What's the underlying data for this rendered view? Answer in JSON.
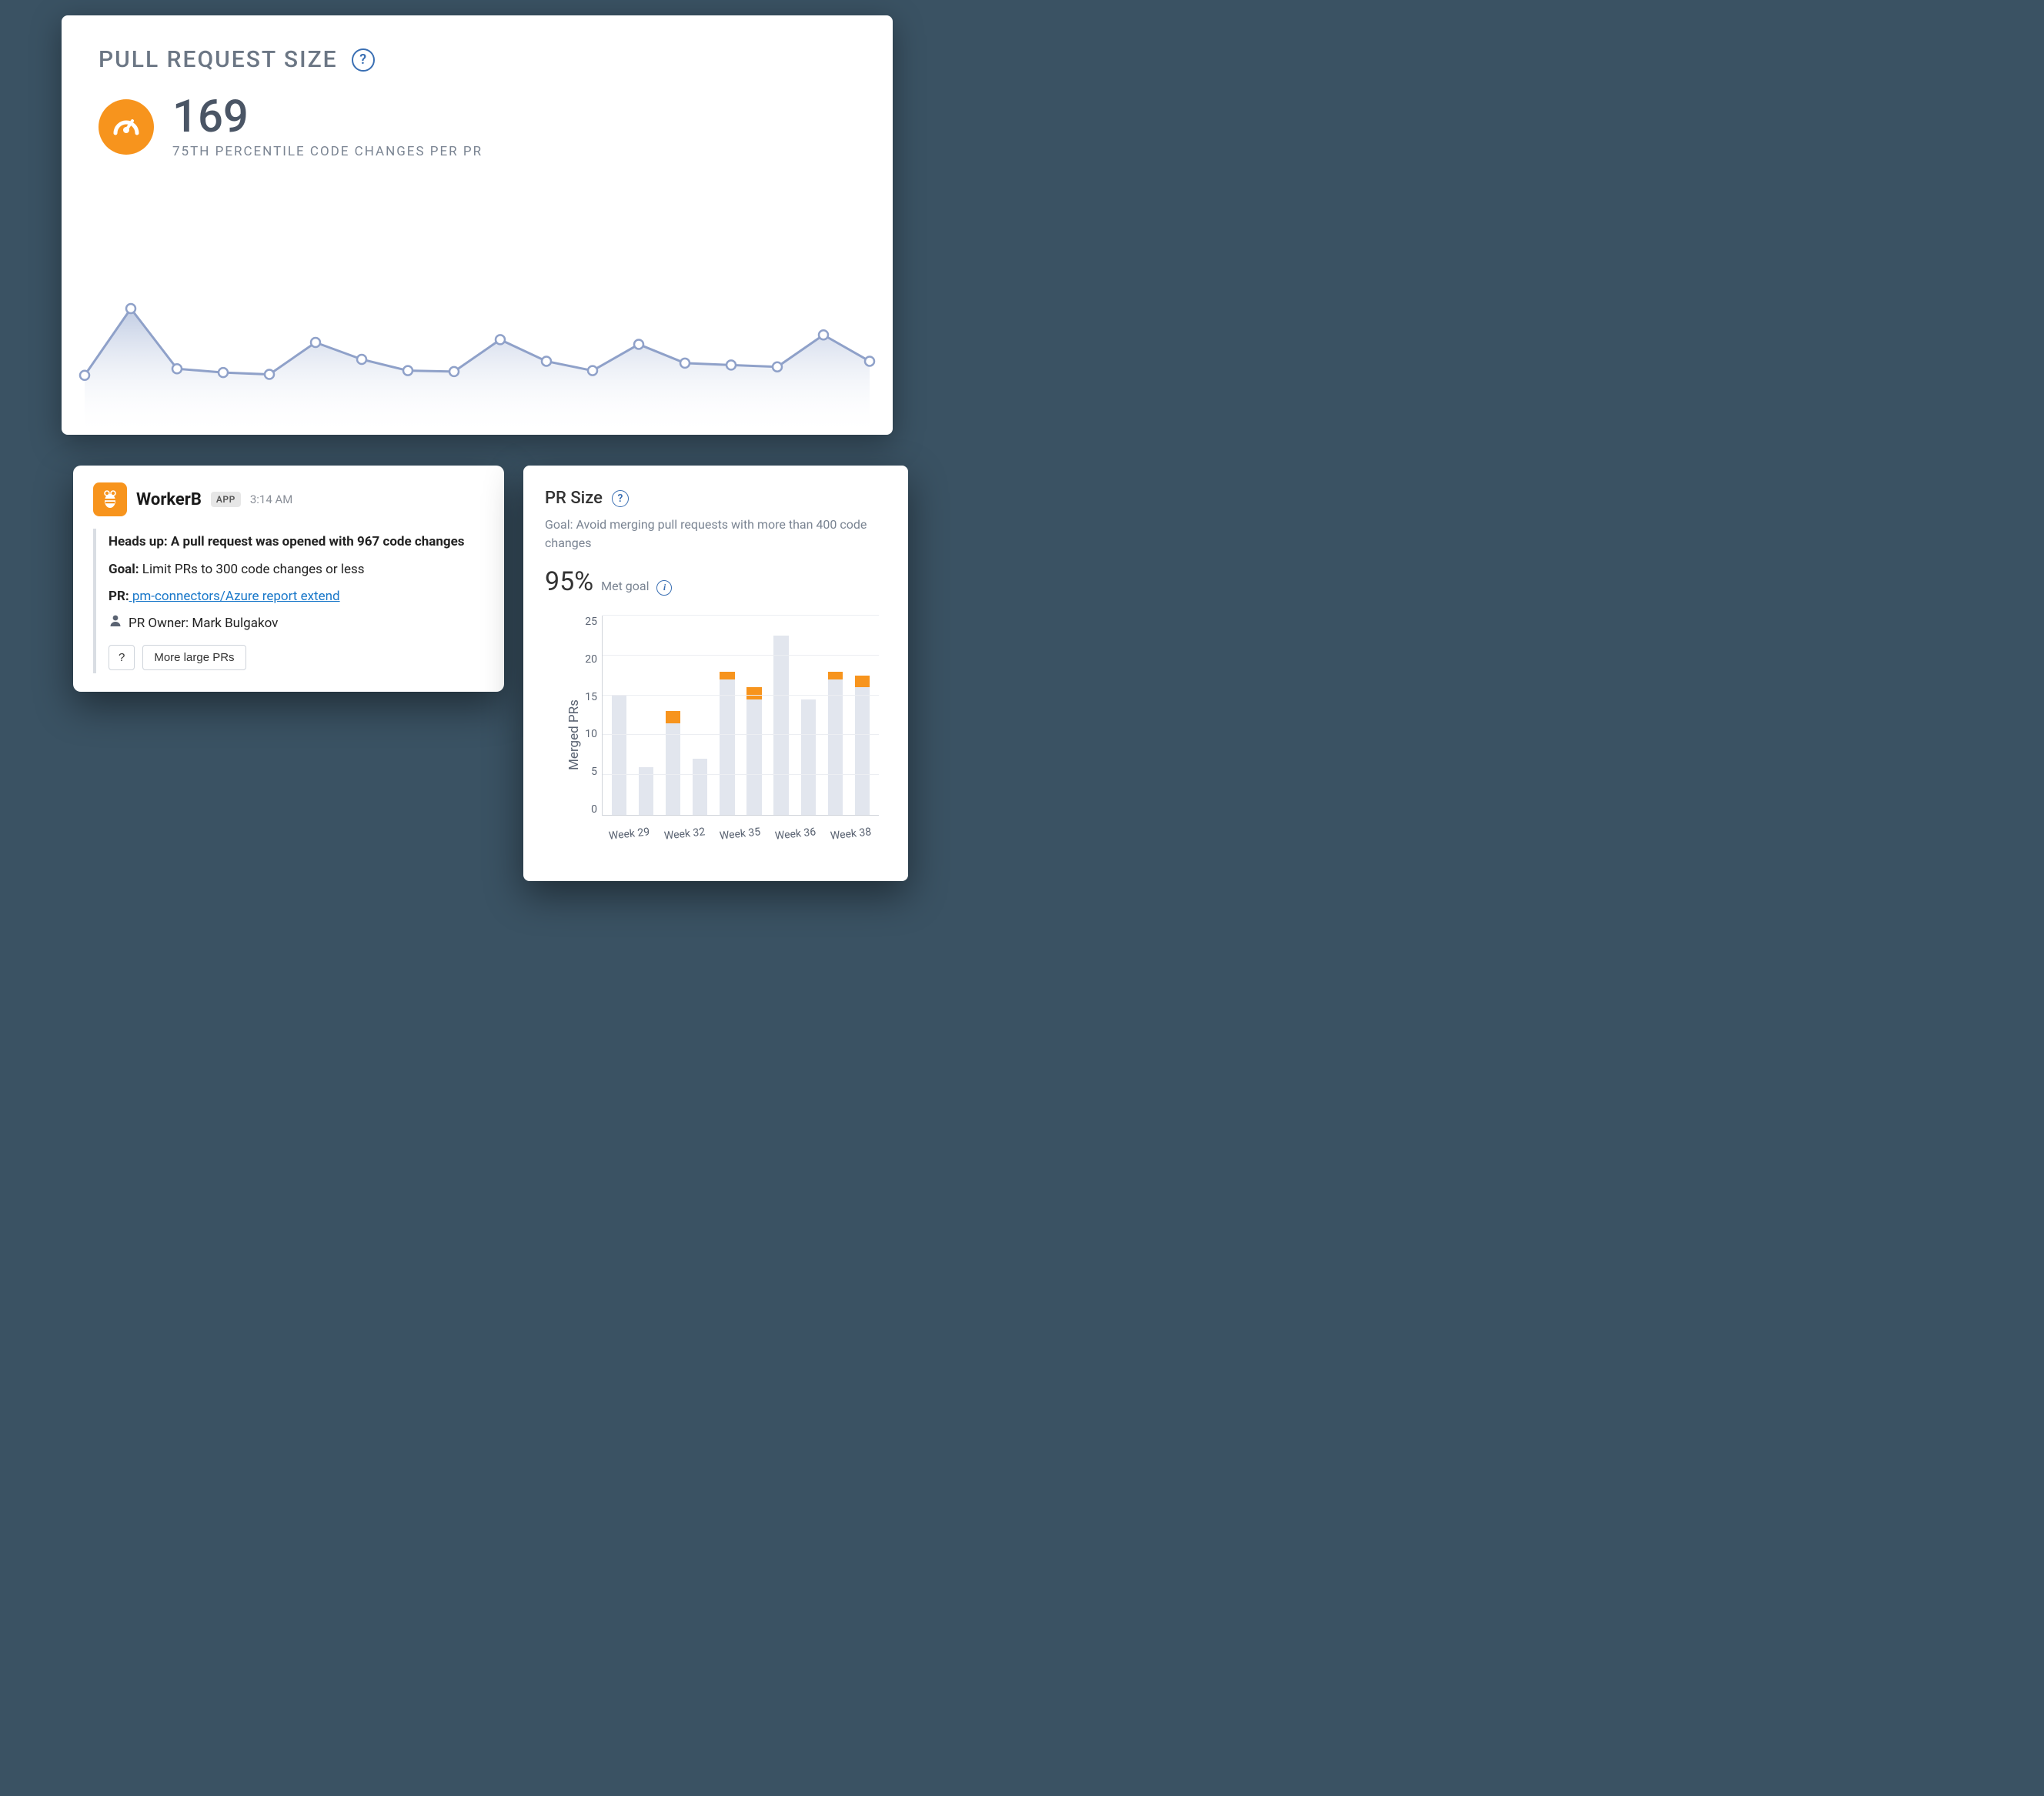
{
  "colors": {
    "accent": "#f7941d",
    "link": "#1877c9",
    "line": "#8fa1c9"
  },
  "top": {
    "title": "PULL REQUEST SIZE",
    "value": "169",
    "subtitle": "75TH PERCENTILE CODE CHANGES PER PR",
    "help_icon": "question-mark-icon",
    "gauge_icon": "gauge-icon"
  },
  "slack": {
    "app_name": "WorkerB",
    "app_badge": "APP",
    "time": "3:14 AM",
    "heads_up": "Heads up: A pull request was opened with 967 code changes",
    "goal_label": "Goal:",
    "goal_text": " Limit PRs to 300 code changes or less",
    "pr_label": "PR:",
    "pr_link": " pm-connectors/Azure report extend",
    "owner_label": "PR Owner: ",
    "owner_name": "Mark Bulgakov",
    "btn_help": "?",
    "btn_more": "More large PRs",
    "bee_icon": "bee-icon",
    "person_icon": "person-icon"
  },
  "prsize": {
    "title": "PR Size",
    "goal": "Goal: Avoid merging pull requests with more than 400 code changes",
    "percent": "95%",
    "met_label": "Met goal",
    "ylabel": "Merged PRs",
    "info_icon": "info-icon"
  },
  "chart_data": [
    {
      "type": "area",
      "name": "pr_size_sparkline",
      "title": "Pull Request Size trend",
      "x": [
        0,
        1,
        2,
        3,
        4,
        5,
        6,
        7,
        8,
        9,
        10,
        11,
        12,
        13,
        14,
        15,
        16,
        17
      ],
      "values": [
        55,
        126,
        62,
        58,
        56,
        90,
        72,
        60,
        59,
        93,
        70,
        60,
        88,
        68,
        66,
        64,
        98,
        70
      ],
      "ylim": [
        0,
        180
      ]
    },
    {
      "type": "bar",
      "name": "pr_size_goal_weekly",
      "title": "PR Size Met Goal by Week",
      "ylabel": "Merged PRs",
      "xlabel": "",
      "ylim": [
        0,
        25
      ],
      "yticks": [
        0,
        5,
        10,
        15,
        20,
        25
      ],
      "categories": [
        "Week 29",
        "",
        "Week 32",
        "",
        "Week 35",
        "",
        "Week 36",
        "",
        "Week 38",
        ""
      ],
      "series": [
        {
          "name": "Met goal",
          "color": "#e2e6ee",
          "values": [
            15,
            6,
            11.5,
            7,
            17,
            14.5,
            22.5,
            14.5,
            17,
            16
          ]
        },
        {
          "name": "Missed goal",
          "color": "#f7941d",
          "values": [
            0,
            0,
            1.5,
            0,
            1,
            1.5,
            0,
            0,
            1,
            1.5
          ]
        }
      ]
    }
  ]
}
